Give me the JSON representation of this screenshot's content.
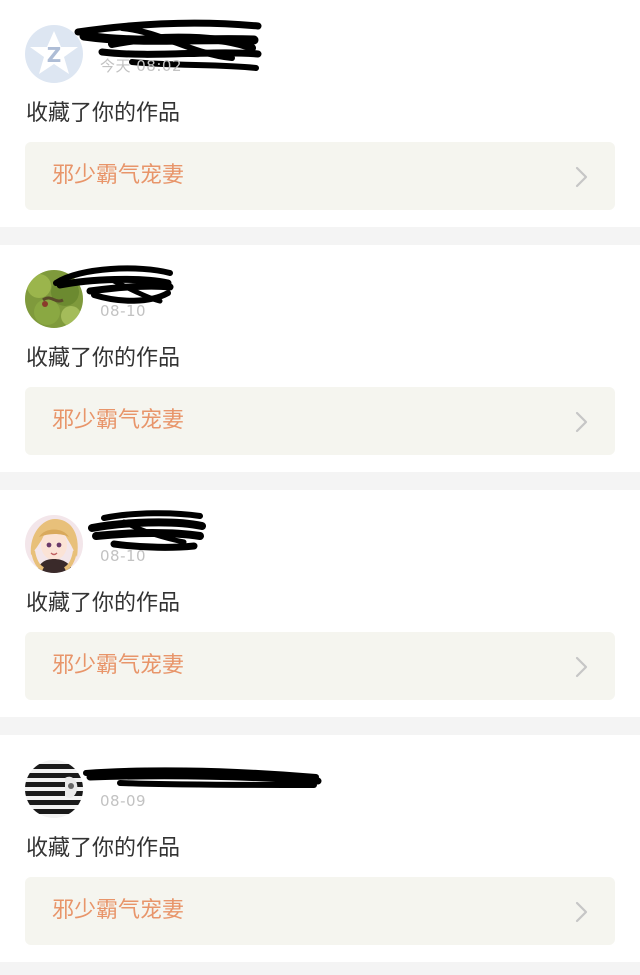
{
  "notifications": [
    {
      "avatar": "default-z-avatar",
      "username": "",
      "time": "今天 08:02",
      "action": "收藏了你的作品",
      "work_title": "邪少霸气宠妻"
    },
    {
      "avatar": "green-leaf-photo-avatar",
      "username": "",
      "time": "08-10",
      "action": "收藏了你的作品",
      "work_title": "邪少霸气宠妻"
    },
    {
      "avatar": "anime-girl-avatar",
      "username": "",
      "time": "08-10",
      "action": "收藏了你的作品",
      "work_title": "邪少霸气宠妻"
    },
    {
      "avatar": "striped-shirt-photo-avatar",
      "username": "",
      "time": "08-09",
      "action": "收藏了你的作品",
      "work_title": "邪少霸气宠妻"
    }
  ],
  "icons": {
    "chevron": "chevron-right-icon"
  },
  "colors": {
    "background": "#f4f4f4",
    "card": "#ffffff",
    "work_box": "#f5f5ef",
    "work_title": "#e8956a",
    "timestamp": "#c2c2c2",
    "text": "#333333"
  }
}
